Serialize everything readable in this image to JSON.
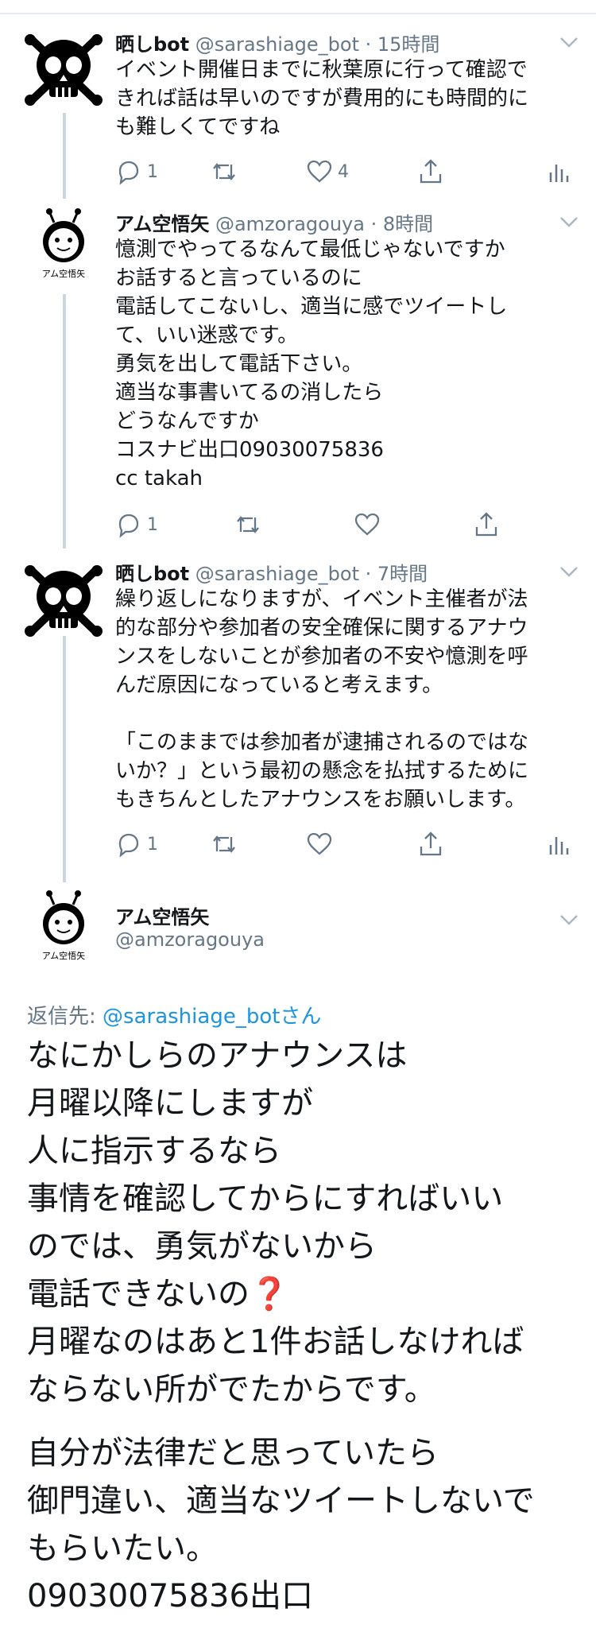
{
  "tweets": [
    {
      "name": "晒しbot",
      "handle": "@sarashiage_bot",
      "time": "· 15時間",
      "text": "イベント開催日までに秋葉原に行って確認で\nきれば話は早いのですが費用的にも時間的に\nも難しくてですね",
      "reply_count": "1",
      "retweet_count": "",
      "like_count": "4",
      "avatar": "skull-icon"
    },
    {
      "name": "アム空悟矢",
      "handle": "@amzoragouya",
      "time": "· 8時間",
      "text": "憶測でやってるなんて最低じゃないですか\nお話すると言っているのに\n電話してこないし、適当に感でツイートし\nて、いい迷惑です。\n勇気を出して電話下さい。\n適当な事書いてるの消したら\nどうなんですか\nコスナビ出口09030075836\ncc takah",
      "reply_count": "1",
      "retweet_count": "",
      "like_count": "",
      "avatar": "panda-logo-icon",
      "avatar_caption": "アム空悟矢"
    },
    {
      "name": "晒しbot",
      "handle": "@sarashiage_bot",
      "time": "· 7時間",
      "text": "繰り返しになりますが、イベント主催者が法\n的な部分や参加者の安全確保に関するアナウ\nンスをしないことが参加者の不安や憶測を呼\nんだ原因になっていると考えます。\n\n「このままでは参加者が逮捕されるのではな\nいか？」という最初の懸念を払拭するために\nもきちんとしたアナウンスをお願いします。",
      "reply_count": "1",
      "retweet_count": "",
      "like_count": "",
      "avatar": "skull-icon"
    }
  ],
  "main": {
    "name": "アム空悟矢",
    "handle": "@amzoragouya",
    "avatar_caption": "アム空悟矢",
    "reply_prefix": "返信先: ",
    "reply_handle": "@sarashiage_botさん",
    "text_part1": "なにかしらのアナウンスは\n月曜以降にしますが\n人に指示するなら\n事情を確認してからにすればいい\nのでは、勇気がないから\n電話できないの",
    "qmark": "❓",
    "text_part2": "月曜なのはあと1件お話しなければ\nならない所がでたからです。",
    "text_part3": "自分が法律だと思っていたら\n御門違い、適当なツイートしないで\nもらいたい。\n09030075836出口"
  },
  "colors": {
    "link": "#1b95e0",
    "secondary": "#657786",
    "thread_line": "#ccd6dd"
  }
}
